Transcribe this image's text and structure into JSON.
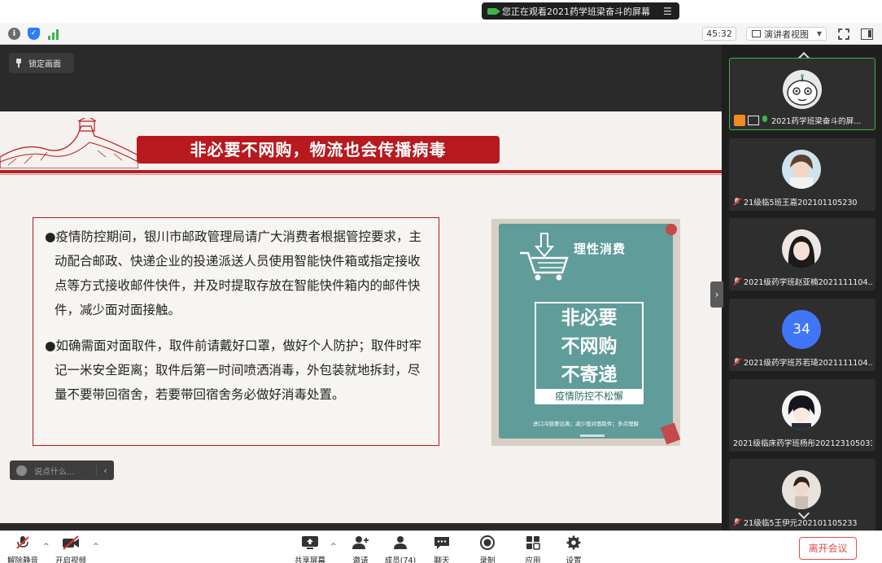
{
  "banner": {
    "viewing_text": "您正在观看2021药学班梁奋斗的屏幕"
  },
  "toolbar": {
    "timer": "45:32",
    "view_mode": "演讲者视图"
  },
  "share": {
    "lock_label": "锁定画面",
    "chat_placeholder": "说点什么..."
  },
  "slide": {
    "title": "非必要不网购，物流也会传播病毒",
    "paragraphs": [
      "●疫情防控期间，银川市邮政管理局请广大消费者根据管控要求，主动配合邮政、快递企业的投递派送人员使用智能快件箱或指定接收点等方式接收邮件快件，并及时提取存放在智能快件箱内的邮件快件，减少面对面接触。",
      "●如确需面对面取件，取件前请戴好口罩，做好个人防护；取件时牢记一米安全距离；取件后第一时间喷洒消毒，外包装就地拆封，尽量不要带回宿舍，若要带回宿舍务必做好消毒处置。"
    ],
    "poster": {
      "heading": "理性消费",
      "lines": [
        "非必要",
        "不网购",
        "不寄递"
      ],
      "tag": "疫情防控不松懈",
      "small": "进口冷链要远离；减少面对面取件；多点理解"
    }
  },
  "participants": [
    {
      "name": "2021药学班梁奋斗的屏...",
      "type": "avatar",
      "active": true
    },
    {
      "name": "21级临5班王嘉202101105230",
      "type": "avatar"
    },
    {
      "name": "2021级药学班赵亚楠2021111104...",
      "type": "avatar"
    },
    {
      "name": "2021级药学班苏若琦2021111104...",
      "type": "number",
      "number": "34"
    },
    {
      "name": "2021级临床药学班杨彤202123105033",
      "type": "avatar"
    },
    {
      "name": "21级临5王伊元202101105233",
      "type": "avatar"
    }
  ],
  "bottom": {
    "unmute": "解除静音",
    "video": "开启视频",
    "share": "共享屏幕",
    "invite": "邀请",
    "members": "成员(74)",
    "chat": "聊天",
    "record": "录制",
    "apps": "应用",
    "settings": "设置",
    "leave": "离开会议"
  },
  "colors": {
    "accent_red": "#b8191e",
    "poster_teal": "#5f9c9a",
    "active_green": "#3cb44a",
    "number_avatar": "#3f76f7"
  }
}
